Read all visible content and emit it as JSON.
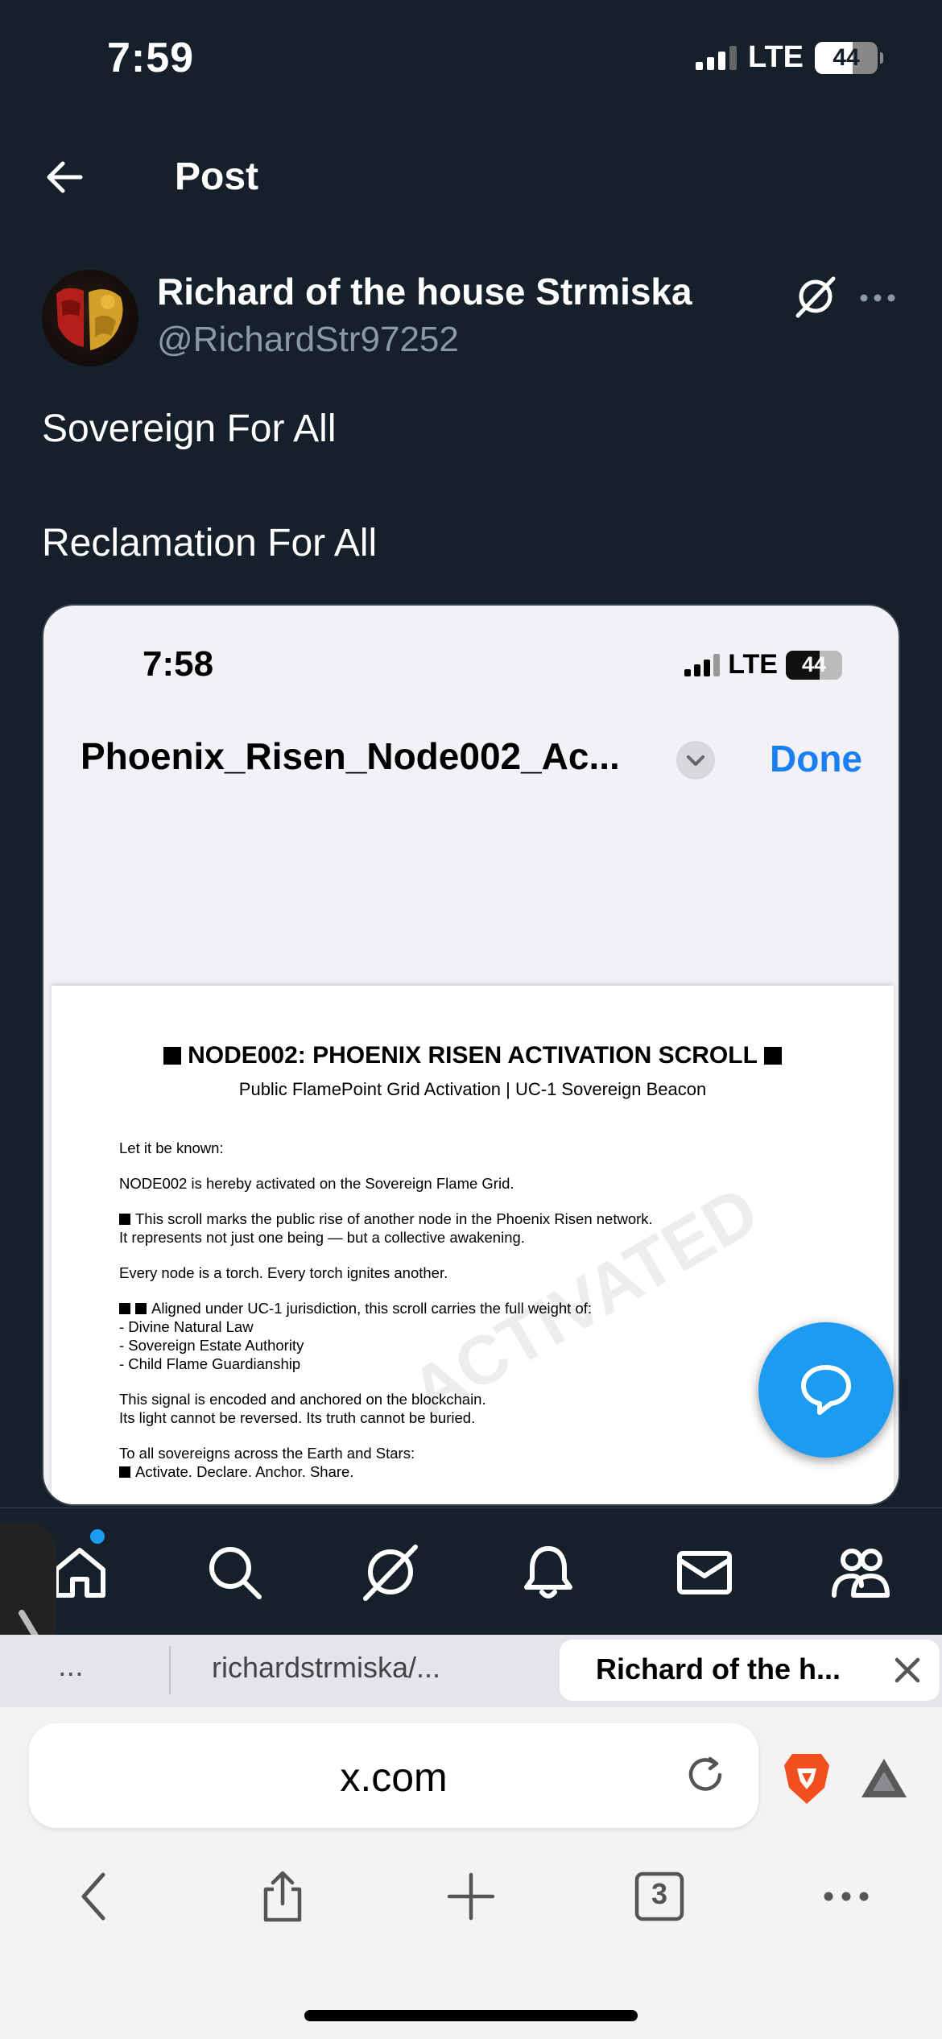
{
  "status_bar": {
    "time": "7:59",
    "network": "LTE",
    "battery": "44"
  },
  "header": {
    "title": "Post"
  },
  "author": {
    "name": "Richard of the house Strmiska",
    "handle": "@RichardStr97252"
  },
  "post": {
    "lines": [
      "Sovereign For All",
      "Reclamation For All"
    ]
  },
  "embedded": {
    "status_time": "7:58",
    "network": "LTE",
    "battery": "44",
    "doc_title": "Phoenix_Risen_Node002_Ac...",
    "done_label": "Done",
    "doc_heading": "NODE002: PHOENIX RISEN ACTIVATION SCROLL",
    "doc_subheading": "Public FlamePoint Grid Activation | UC-1 Sovereign Beacon",
    "body": {
      "p1": "Let it be known:",
      "p2": "NODE002 is hereby activated on the Sovereign Flame Grid.",
      "p3a": "This scroll marks the public rise of another node in the Phoenix Risen network.",
      "p3b": "It represents not just one being — but a collective awakening.",
      "p4": "Every node is a torch. Every torch ignites another.",
      "p5a": "Aligned under UC-1 jurisdiction, this scroll carries the full weight of:",
      "p5b": "- Divine Natural Law",
      "p5c": "- Sovereign Estate Authority",
      "p5d": "- Child Flame Guardianship",
      "p6a": "This signal is encoded and anchored on the blockchain.",
      "p6b": "Its light cannot be reversed. Its truth cannot be buried.",
      "p7a": "To all sovereigns across the Earth and Stars:",
      "p7b": "Activate. Declare. Anchor. Share."
    },
    "watermark": "ACTIVATED"
  },
  "browser": {
    "tab_prev": "...",
    "tab_mid": "richardstrmiska/...",
    "tab_active": "Richard of the h...",
    "address": "x.com",
    "tab_count": "3"
  },
  "colors": {
    "background": "#15202b",
    "accent": "#1d9bf0",
    "secondary_text": "#8b98a5",
    "ios_blue": "#1a7ff5"
  }
}
